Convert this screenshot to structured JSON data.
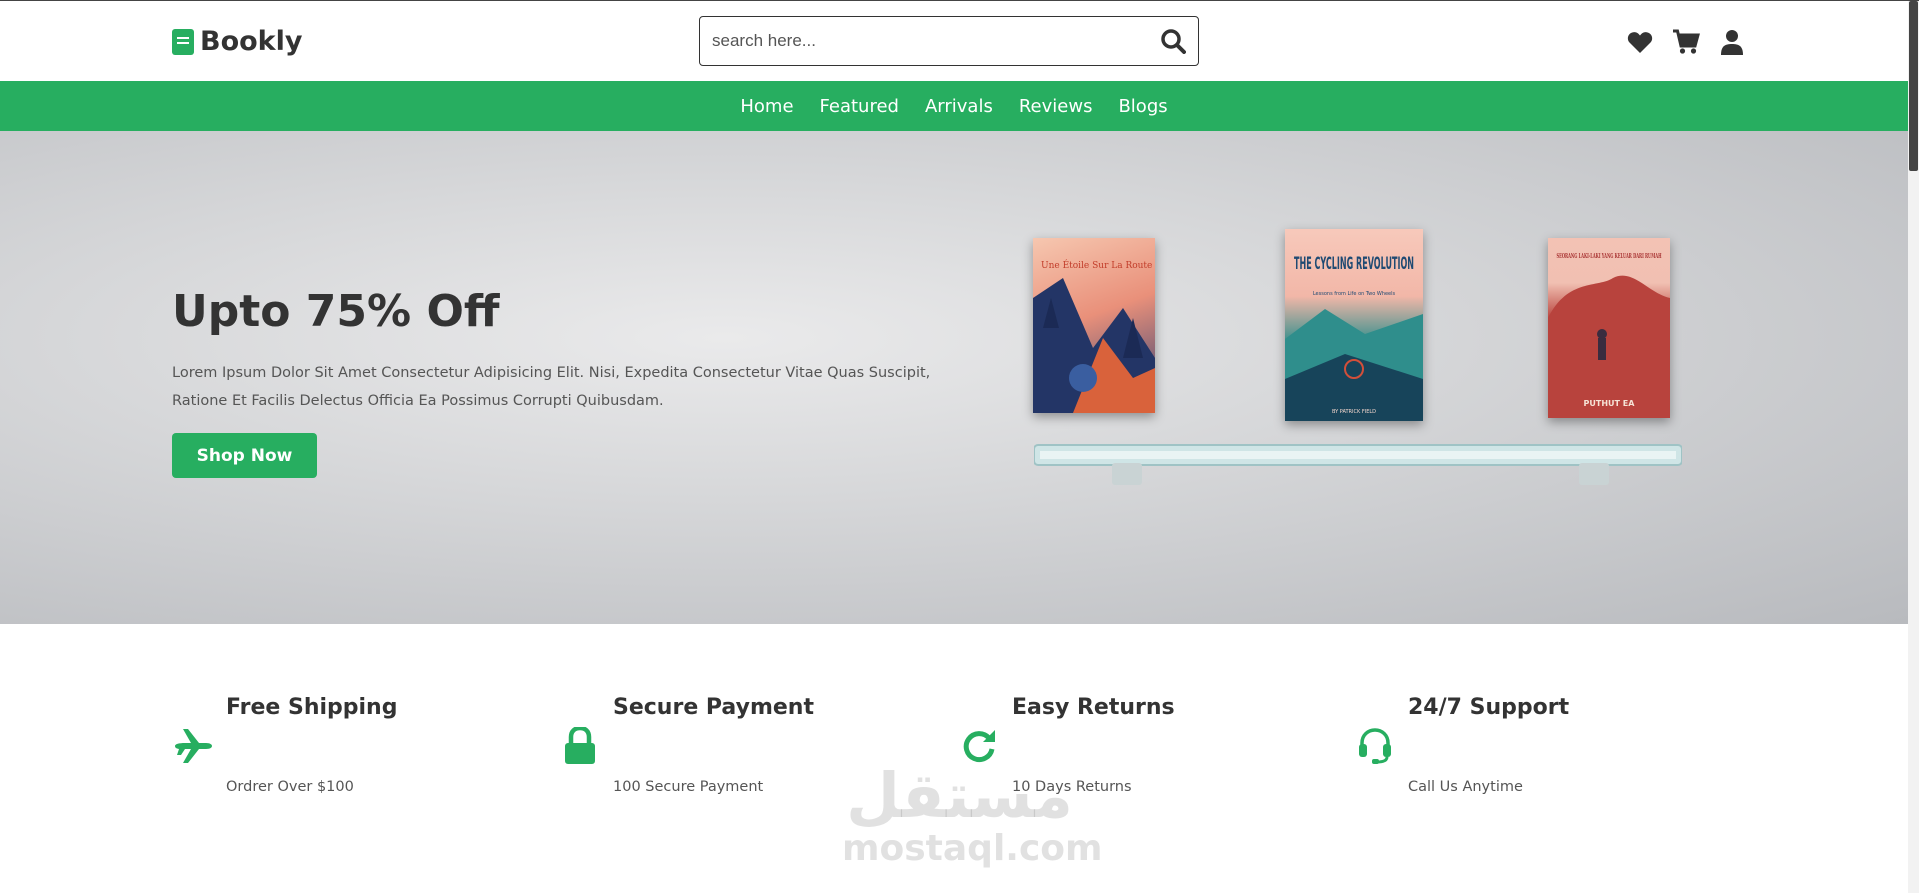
{
  "brand": {
    "name": "Bookly",
    "accent": "#27ae60"
  },
  "search": {
    "placeholder": "search here..."
  },
  "header_icons": [
    "heart-icon",
    "cart-icon",
    "user-icon"
  ],
  "nav": {
    "items": [
      {
        "label": "Home"
      },
      {
        "label": "Featured"
      },
      {
        "label": "Arrivals"
      },
      {
        "label": "Reviews"
      },
      {
        "label": "Blogs"
      }
    ]
  },
  "hero": {
    "title": "Upto 75% Off",
    "description": "Lorem Ipsum Dolor Sit Amet Consectetur Adipisicing Elit. Nisi, Expedita Consectetur Vitae Quas Suscipit, Ratione Et Facilis Delectus Officia Ea Possimus Corrupti Quibusdam.",
    "button_label": "Shop Now",
    "books": [
      {
        "title": "Une Étoile Sur La Route"
      },
      {
        "title": "THE CYCLING REVOLUTION",
        "subtitle": "Lessons from Life on Two Wheels",
        "author": "BY PATRICK FIELD"
      },
      {
        "title": "SEORANG LAKI-LAKI YANG KELUAR DARI RUMAH",
        "author": "PUTHUT EA"
      }
    ]
  },
  "features": [
    {
      "icon": "plane-icon",
      "title": "Free Shipping",
      "subtitle": "Ordrer Over $100"
    },
    {
      "icon": "lock-icon",
      "title": "Secure Payment",
      "subtitle": "100 Secure Payment"
    },
    {
      "icon": "redo-icon",
      "title": "Easy Returns",
      "subtitle": "10 Days Returns"
    },
    {
      "icon": "headset-icon",
      "title": "24/7 Support",
      "subtitle": "Call Us Anytime"
    }
  ],
  "watermark": {
    "arabic": "مستقل",
    "latin": "mostaql.com"
  }
}
